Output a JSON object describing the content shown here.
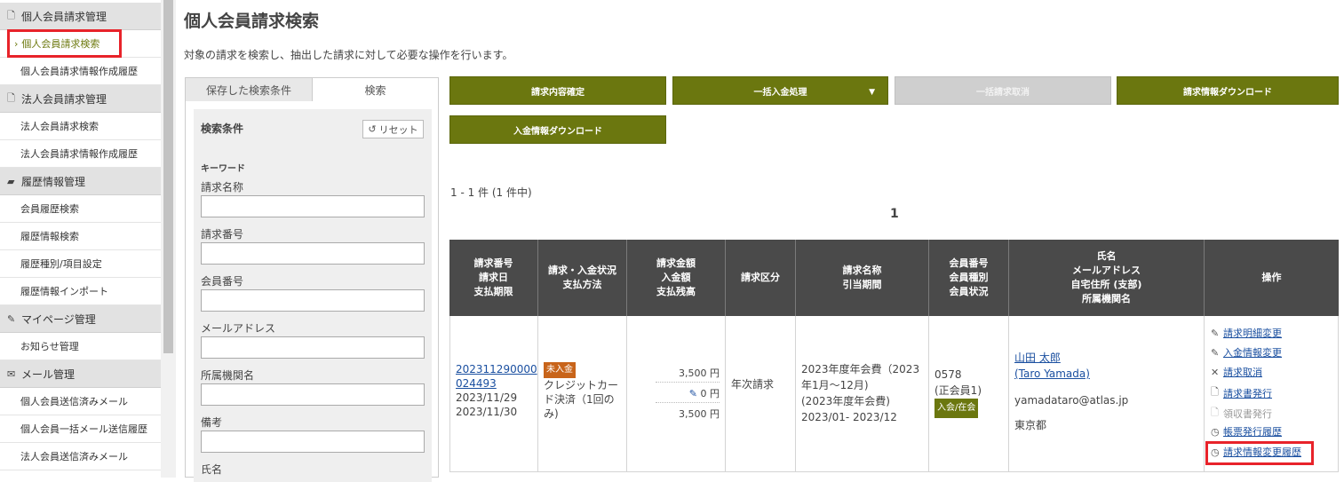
{
  "sidebar": {
    "sections": [
      {
        "title": "個人会員請求管理",
        "icon": "document-icon",
        "items": [
          "個人会員請求検索",
          "個人会員請求情報作成履歴"
        ]
      },
      {
        "title": "法人会員請求管理",
        "icon": "document-icon",
        "items": [
          "法人会員請求検索",
          "法人会員請求情報作成履歴"
        ]
      },
      {
        "title": "履歴情報管理",
        "icon": "folder-open-icon",
        "items": [
          "会員履歴検索",
          "履歴情報検索",
          "履歴種別/項目設定",
          "履歴情報インポート"
        ]
      },
      {
        "title": "マイページ管理",
        "icon": "pen-icon",
        "items": [
          "お知らせ管理"
        ]
      },
      {
        "title": "メール管理",
        "icon": "mail-icon",
        "items": [
          "個人会員送信済みメール",
          "個人会員一括メール送信履歴",
          "法人会員送信済みメール"
        ]
      }
    ],
    "active_item": "個人会員請求検索"
  },
  "page": {
    "title": "個人会員請求検索",
    "description": "対象の請求を検索し、抽出した請求に対して必要な操作を行います。"
  },
  "search_panel": {
    "tabs": [
      "保存した検索条件",
      "検索"
    ],
    "condition_title": "検索条件",
    "reset_label": "リセット",
    "keyword_label": "キーワード",
    "fields": [
      {
        "label": "請求名称",
        "value": ""
      },
      {
        "label": "請求番号",
        "value": ""
      },
      {
        "label": "会員番号",
        "value": ""
      },
      {
        "label": "メールアドレス",
        "value": ""
      },
      {
        "label": "所属機関名",
        "value": ""
      },
      {
        "label": "備考",
        "value": ""
      },
      {
        "label": "氏名",
        "value": ""
      }
    ]
  },
  "actions": {
    "confirm": "請求内容確定",
    "bulk_payment": "一括入金処理",
    "bulk_cancel": "一括請求取消",
    "download_invoice": "請求情報ダウンロード",
    "download_payment": "入金情報ダウンロード"
  },
  "results": {
    "count_text": "1 - 1 件 (1 件中)",
    "current_page": "1"
  },
  "table": {
    "headers": [
      [
        "請求番号",
        "請求日",
        "支払期限"
      ],
      [
        "請求・入金状況",
        "支払方法"
      ],
      [
        "請求金額",
        "入金額",
        "支払残高"
      ],
      [
        "請求区分"
      ],
      [
        "請求名称",
        "引当期間"
      ],
      [
        "会員番号",
        "会員種別",
        "会員状況"
      ],
      [
        "氏名",
        "メールアドレス",
        "自宅住所 (支部)",
        "所属機関名"
      ],
      [
        "操作"
      ]
    ],
    "row": {
      "invoice_no_line1": "202311290000",
      "invoice_no_line2": "024493",
      "invoice_date": "2023/11/29",
      "due_date": "2023/11/30",
      "status_badge": "未入金",
      "payment_method": [
        "クレジットカー",
        "ド決済（1回の",
        "み)"
      ],
      "amount": "3,500 円",
      "paid": "0 円",
      "balance": "3,500 円",
      "category": "年次請求",
      "name_lines": [
        "2023年度年会費（2023",
        "年1月～12月)",
        "(2023年度年会費)",
        "2023/01- 2023/12"
      ],
      "member_no": "0578",
      "member_type": "(正会員1)",
      "member_status": "入会/在会",
      "person_name": "山田 太郎",
      "person_name_en": "(Taro Yamada)",
      "email": "yamadataro@atlas.jp",
      "address": "東京都",
      "operations": [
        {
          "label": "請求明細変更",
          "icon": "pencil-icon",
          "enabled": true
        },
        {
          "label": "入金情報変更",
          "icon": "pencil-icon",
          "enabled": true
        },
        {
          "label": "請求取消",
          "icon": "x-icon",
          "enabled": true
        },
        {
          "label": "請求書発行",
          "icon": "document-icon",
          "enabled": true
        },
        {
          "label": "領収書発行",
          "icon": "document-icon",
          "enabled": false
        },
        {
          "label": "帳票発行履歴",
          "icon": "history-icon",
          "enabled": true
        },
        {
          "label": "請求情報変更履歴",
          "icon": "history-icon",
          "enabled": true
        }
      ]
    }
  },
  "colors": {
    "accent": "#6b770f",
    "header_bg": "#4a4a4a",
    "highlight": "#e8232a",
    "link": "#1a4fa0"
  }
}
